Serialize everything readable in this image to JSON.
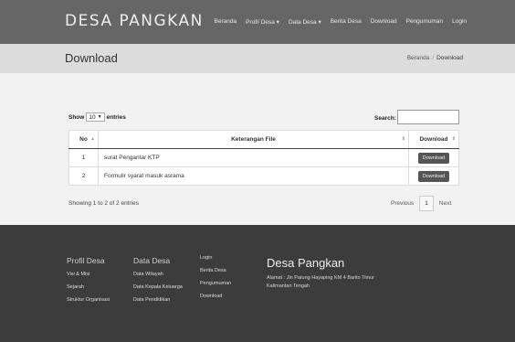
{
  "header": {
    "brand": "DESA PANGKAN",
    "nav": [
      {
        "label": "Beranda"
      },
      {
        "label": "Profil Desa ▾"
      },
      {
        "label": "Data Desa ▾"
      },
      {
        "label": "Berita Desa"
      },
      {
        "label": "Download"
      },
      {
        "label": "Pengumuman"
      },
      {
        "label": "Login"
      }
    ]
  },
  "page": {
    "title": "Download",
    "breadcrumb": {
      "home": "Beranda",
      "separator": "/",
      "current": "Download"
    }
  },
  "table_controls": {
    "show_label": "Show",
    "entries_value": "10",
    "entries_label": "entries",
    "search_label": "Search:",
    "search_value": ""
  },
  "table": {
    "headers": {
      "no": "No",
      "file": "Keterangan File",
      "download": "Download"
    },
    "rows": [
      {
        "no": "1",
        "file": "surat Pengantar KTP",
        "action": "Download"
      },
      {
        "no": "2",
        "file": "Formulir syarat masuk asrama",
        "action": "Download"
      }
    ]
  },
  "pagination": {
    "info": "Showing 1 to 2 of 2 entries",
    "previous": "Previous",
    "current_page": "1",
    "next": "Next"
  },
  "footer": {
    "profil": {
      "heading": "Profil Desa",
      "items": [
        "Visi & Misi",
        "Sejarah",
        "Struktur Organisasi"
      ]
    },
    "data": {
      "heading": "Data Desa",
      "items": [
        "Data Wilayah",
        "Data Kepala Keluarga",
        "Data Pendidikan"
      ]
    },
    "links": {
      "items": [
        "Login",
        "Berita Desa",
        "Pengumuman",
        "Download"
      ]
    },
    "site_name": "Desa Pangkan",
    "address": "Alamat : Jln Patung Hayaping KM 4 Barito Timur Kalimantan Tengah"
  },
  "colors": {
    "topbar": "#666666",
    "pagehead": "#dcdcdc",
    "content": "#f2f2f2",
    "footer": "#3c3c3c",
    "button": "#555555"
  },
  "icons": {
    "sort_ascending": "sort-up-icon",
    "sort_both": "sort-icon",
    "dropdown": "chevron-down-icon"
  }
}
